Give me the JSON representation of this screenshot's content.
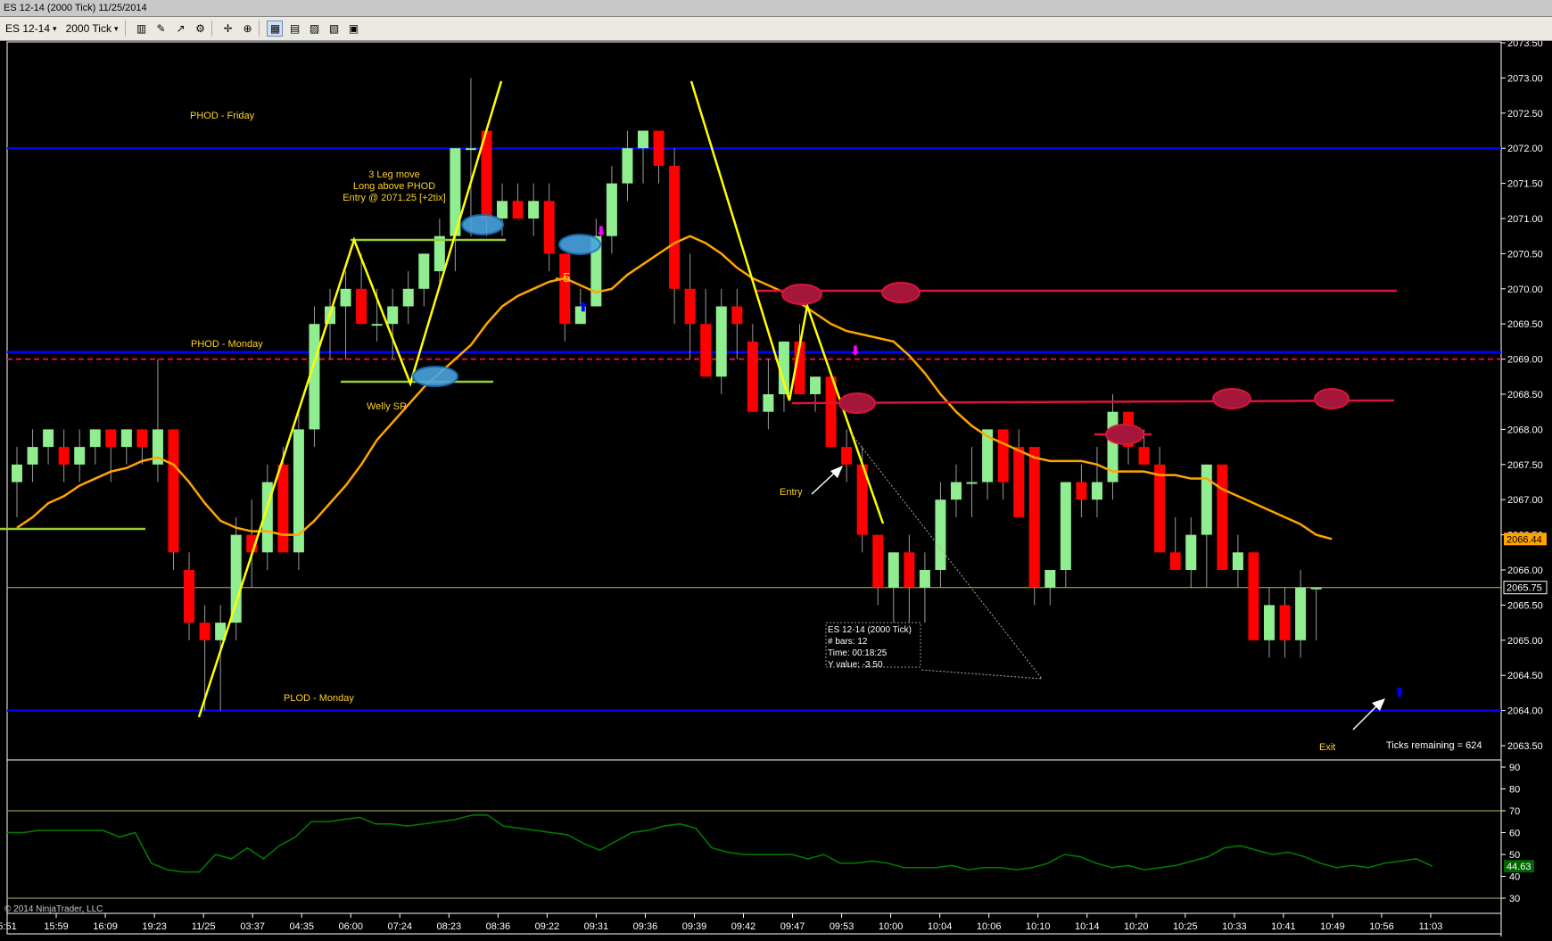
{
  "window": {
    "title": "ES 12-14 (2000 Tick)  11/25/2014"
  },
  "toolbar": {
    "instrument": "ES 12-14",
    "interval": "2000 Tick",
    "icons": [
      "bar-type-icon",
      "pencil-draw-icon",
      "add-indicator-icon",
      "strategy-icon",
      "crosshair-icon",
      "zoom-icon",
      "data-box-icon",
      "chart-settings-icon",
      "chart-trader-icon",
      "properties-icon",
      "print-icon",
      "template-icon"
    ]
  },
  "colors": {
    "up_bar": "#90ee90",
    "down_bar": "#ff0000",
    "ema": "#ffa500",
    "level_blue": "#0000ff",
    "resistance_red": "#dc143c",
    "annotation_yellow": "#ffd21e",
    "oscillator_green": "#008000"
  },
  "price_axis": {
    "ticks": [
      "2073.50",
      "2073.00",
      "2072.50",
      "2072.00",
      "2071.50",
      "2071.00",
      "2070.50",
      "2070.00",
      "2069.50",
      "2069.00",
      "2068.50",
      "2068.00",
      "2067.50",
      "2067.00",
      "2066.50",
      "2066.00",
      "2065.50",
      "2065.00",
      "2064.50",
      "2064.00",
      "2063.50"
    ],
    "ema_label": "2066.44",
    "last_price_label": "2065.75"
  },
  "osc_axis": {
    "ticks": [
      "90",
      "80",
      "70",
      "60",
      "50",
      "40",
      "30"
    ],
    "current_label": "44.63"
  },
  "time_axis": [
    "5:51",
    "15:59",
    "16:09",
    "19:23",
    "11/25",
    "03:37",
    "04:35",
    "06:00",
    "07:24",
    "08:23",
    "08:36",
    "09:22",
    "09:31",
    "09:36",
    "09:39",
    "09:42",
    "09:47",
    "09:53",
    "10:00",
    "10:04",
    "10:06",
    "10:10",
    "10:14",
    "10:20",
    "10:25",
    "10:33",
    "10:41",
    "10:49",
    "10:56",
    "11:03"
  ],
  "annotations": {
    "phod_friday": "PHOD - Friday",
    "phod_monday": "PHOD - Monday",
    "plod_monday": "PLOD - Monday",
    "three_leg_1": "3 Leg move",
    "three_leg_2": "Long above PHOD",
    "three_leg_3": "Entry @ 2071.25 [+2tix]",
    "welly_sr": "Welly SR",
    "minus_five": "- 5",
    "entry": "Entry",
    "exit": "Exit",
    "ticks_remaining": "Ticks remaining = 624",
    "copyright": "© 2014 NinjaTrader, LLC"
  },
  "databox": {
    "line1": "ES 12-14 (2000 Tick)",
    "line2": "# bars:    12",
    "line3": "Time:      00:18:25",
    "line4": "Y value:  -3.50"
  },
  "chart_data": {
    "type": "candlestick",
    "instrument": "ES 12-14",
    "interval": "2000 Tick",
    "bars": [
      {
        "o": 2067.25,
        "h": 2067.75,
        "l": 2066.75,
        "c": 2067.5
      },
      {
        "o": 2067.5,
        "h": 2068.0,
        "l": 2067.25,
        "c": 2067.75
      },
      {
        "o": 2067.75,
        "h": 2068.0,
        "l": 2067.5,
        "c": 2068.0
      },
      {
        "o": 2067.75,
        "h": 2068.0,
        "l": 2067.25,
        "c": 2067.5
      },
      {
        "o": 2067.5,
        "h": 2068.0,
        "l": 2067.25,
        "c": 2067.75
      },
      {
        "o": 2067.75,
        "h": 2068.0,
        "l": 2067.5,
        "c": 2068.0
      },
      {
        "o": 2068.0,
        "h": 2068.0,
        "l": 2067.25,
        "c": 2067.75
      },
      {
        "o": 2067.75,
        "h": 2068.0,
        "l": 2067.5,
        "c": 2068.0
      },
      {
        "o": 2068.0,
        "h": 2068.0,
        "l": 2067.5,
        "c": 2067.75
      },
      {
        "o": 2067.5,
        "h": 2069.0,
        "l": 2067.25,
        "c": 2068.0
      },
      {
        "o": 2068.0,
        "h": 2068.0,
        "l": 2066.0,
        "c": 2066.25
      },
      {
        "o": 2066.0,
        "h": 2066.25,
        "l": 2065.0,
        "c": 2065.25
      },
      {
        "o": 2065.25,
        "h": 2065.5,
        "l": 2064.0,
        "c": 2065.0
      },
      {
        "o": 2065.0,
        "h": 2065.5,
        "l": 2064.0,
        "c": 2065.25
      },
      {
        "o": 2065.25,
        "h": 2066.75,
        "l": 2065.0,
        "c": 2066.5
      },
      {
        "o": 2066.5,
        "h": 2067.0,
        "l": 2065.75,
        "c": 2066.25
      },
      {
        "o": 2066.25,
        "h": 2067.5,
        "l": 2066.0,
        "c": 2067.25
      },
      {
        "o": 2067.5,
        "h": 2067.75,
        "l": 2066.25,
        "c": 2066.25
      },
      {
        "o": 2066.25,
        "h": 2068.25,
        "l": 2066.0,
        "c": 2068.0
      },
      {
        "o": 2068.0,
        "h": 2069.75,
        "l": 2067.75,
        "c": 2069.5
      },
      {
        "o": 2069.5,
        "h": 2070.0,
        "l": 2069.0,
        "c": 2069.75
      },
      {
        "o": 2069.75,
        "h": 2070.25,
        "l": 2069.0,
        "c": 2070.0
      },
      {
        "o": 2070.0,
        "h": 2070.5,
        "l": 2069.5,
        "c": 2069.5
      },
      {
        "o": 2069.5,
        "h": 2070.0,
        "l": 2069.25,
        "c": 2069.5
      },
      {
        "o": 2069.5,
        "h": 2070.0,
        "l": 2069.0,
        "c": 2069.75
      },
      {
        "o": 2069.75,
        "h": 2070.25,
        "l": 2069.5,
        "c": 2070.0
      },
      {
        "o": 2070.0,
        "h": 2070.5,
        "l": 2069.75,
        "c": 2070.5
      },
      {
        "o": 2070.25,
        "h": 2071.0,
        "l": 2070.0,
        "c": 2070.75
      },
      {
        "o": 2070.75,
        "h": 2072.0,
        "l": 2070.25,
        "c": 2072.0
      },
      {
        "o": 2072.0,
        "h": 2073.0,
        "l": 2070.75,
        "c": 2072.0
      },
      {
        "o": 2072.25,
        "h": 2072.25,
        "l": 2070.75,
        "c": 2071.0
      },
      {
        "o": 2071.0,
        "h": 2071.5,
        "l": 2070.75,
        "c": 2071.25
      },
      {
        "o": 2071.25,
        "h": 2071.5,
        "l": 2071.0,
        "c": 2071.0
      },
      {
        "o": 2071.0,
        "h": 2071.5,
        "l": 2070.75,
        "c": 2071.25
      },
      {
        "o": 2071.25,
        "h": 2071.5,
        "l": 2070.25,
        "c": 2070.5
      },
      {
        "o": 2070.5,
        "h": 2070.5,
        "l": 2069.25,
        "c": 2069.5
      },
      {
        "o": 2069.5,
        "h": 2070.0,
        "l": 2069.5,
        "c": 2069.75
      },
      {
        "o": 2069.75,
        "h": 2071.0,
        "l": 2069.75,
        "c": 2070.75
      },
      {
        "o": 2070.75,
        "h": 2071.75,
        "l": 2070.5,
        "c": 2071.5
      },
      {
        "o": 2071.5,
        "h": 2072.25,
        "l": 2071.25,
        "c": 2072.0
      },
      {
        "o": 2072.0,
        "h": 2072.25,
        "l": 2071.5,
        "c": 2072.25
      },
      {
        "o": 2072.25,
        "h": 2072.25,
        "l": 2071.5,
        "c": 2071.75
      },
      {
        "o": 2071.75,
        "h": 2072.0,
        "l": 2069.5,
        "c": 2070.0
      },
      {
        "o": 2070.0,
        "h": 2070.5,
        "l": 2069.0,
        "c": 2069.5
      },
      {
        "o": 2069.5,
        "h": 2070.0,
        "l": 2068.75,
        "c": 2068.75
      },
      {
        "o": 2068.75,
        "h": 2070.0,
        "l": 2068.5,
        "c": 2069.75
      },
      {
        "o": 2069.75,
        "h": 2070.0,
        "l": 2069.0,
        "c": 2069.5
      },
      {
        "o": 2069.25,
        "h": 2069.5,
        "l": 2068.25,
        "c": 2068.25
      },
      {
        "o": 2068.25,
        "h": 2069.0,
        "l": 2068.0,
        "c": 2068.5
      },
      {
        "o": 2068.5,
        "h": 2069.25,
        "l": 2068.25,
        "c": 2069.25
      },
      {
        "o": 2069.25,
        "h": 2069.5,
        "l": 2068.5,
        "c": 2068.5
      },
      {
        "o": 2068.5,
        "h": 2068.75,
        "l": 2068.25,
        "c": 2068.75
      },
      {
        "o": 2068.75,
        "h": 2068.75,
        "l": 2067.75,
        "c": 2067.75
      },
      {
        "o": 2067.75,
        "h": 2068.0,
        "l": 2067.25,
        "c": 2067.5
      },
      {
        "o": 2067.5,
        "h": 2067.75,
        "l": 2066.25,
        "c": 2066.5
      },
      {
        "o": 2066.5,
        "h": 2066.5,
        "l": 2065.5,
        "c": 2065.75
      },
      {
        "o": 2065.75,
        "h": 2066.25,
        "l": 2065.25,
        "c": 2066.25
      },
      {
        "o": 2066.25,
        "h": 2066.5,
        "l": 2065.25,
        "c": 2065.75
      },
      {
        "o": 2065.75,
        "h": 2066.25,
        "l": 2065.25,
        "c": 2066.0
      },
      {
        "o": 2066.0,
        "h": 2067.25,
        "l": 2065.75,
        "c": 2067.0
      },
      {
        "o": 2067.0,
        "h": 2067.5,
        "l": 2066.75,
        "c": 2067.25
      },
      {
        "o": 2067.25,
        "h": 2067.75,
        "l": 2066.75,
        "c": 2067.25
      },
      {
        "o": 2067.25,
        "h": 2068.0,
        "l": 2067.0,
        "c": 2068.0
      },
      {
        "o": 2068.0,
        "h": 2068.0,
        "l": 2067.0,
        "c": 2067.25
      },
      {
        "o": 2067.75,
        "h": 2068.0,
        "l": 2066.75,
        "c": 2066.75
      },
      {
        "o": 2067.75,
        "h": 2067.75,
        "l": 2065.5,
        "c": 2065.75
      },
      {
        "o": 2065.75,
        "h": 2066.0,
        "l": 2065.5,
        "c": 2066.0
      },
      {
        "o": 2066.0,
        "h": 2067.25,
        "l": 2065.75,
        "c": 2067.25
      },
      {
        "o": 2067.25,
        "h": 2067.5,
        "l": 2066.75,
        "c": 2067.0
      },
      {
        "o": 2067.0,
        "h": 2067.75,
        "l": 2066.75,
        "c": 2067.25
      },
      {
        "o": 2067.25,
        "h": 2068.5,
        "l": 2067.0,
        "c": 2068.25
      },
      {
        "o": 2068.25,
        "h": 2068.25,
        "l": 2067.5,
        "c": 2067.75
      },
      {
        "o": 2067.75,
        "h": 2068.0,
        "l": 2067.5,
        "c": 2067.5
      },
      {
        "o": 2067.5,
        "h": 2067.75,
        "l": 2066.25,
        "c": 2066.25
      },
      {
        "o": 2066.25,
        "h": 2066.75,
        "l": 2066.0,
        "c": 2066.0
      },
      {
        "o": 2066.0,
        "h": 2066.75,
        "l": 2065.75,
        "c": 2066.5
      },
      {
        "o": 2066.5,
        "h": 2067.5,
        "l": 2065.75,
        "c": 2067.5
      },
      {
        "o": 2067.5,
        "h": 2067.5,
        "l": 2066.0,
        "c": 2066.0
      },
      {
        "o": 2066.0,
        "h": 2066.5,
        "l": 2065.75,
        "c": 2066.25
      },
      {
        "o": 2066.25,
        "h": 2066.25,
        "l": 2065.0,
        "c": 2065.0
      },
      {
        "o": 2065.0,
        "h": 2065.75,
        "l": 2064.75,
        "c": 2065.5
      },
      {
        "o": 2065.5,
        "h": 2065.75,
        "l": 2064.75,
        "c": 2065.0
      },
      {
        "o": 2065.0,
        "h": 2066.0,
        "l": 2064.75,
        "c": 2065.75
      },
      {
        "o": 2065.75,
        "h": 2065.75,
        "l": 2065.0,
        "c": 2065.75
      }
    ],
    "ema": [
      2066.6,
      2066.75,
      2066.95,
      2067.05,
      2067.2,
      2067.3,
      2067.4,
      2067.45,
      2067.55,
      2067.6,
      2067.5,
      2067.25,
      2066.95,
      2066.7,
      2066.6,
      2066.55,
      2066.55,
      2066.5,
      2066.5,
      2066.7,
      2066.95,
      2067.2,
      2067.5,
      2067.85,
      2068.1,
      2068.35,
      2068.6,
      2068.8,
      2069.0,
      2069.2,
      2069.5,
      2069.75,
      2069.9,
      2070.0,
      2070.1,
      2070.15,
      2070.05,
      2069.95,
      2070.0,
      2070.2,
      2070.35,
      2070.5,
      2070.65,
      2070.75,
      2070.65,
      2070.5,
      2070.3,
      2070.15,
      2070.05,
      2069.95,
      2069.8,
      2069.65,
      2069.5,
      2069.4,
      2069.35,
      2069.3,
      2069.25,
      2069.05,
      2068.8,
      2068.5,
      2068.25,
      2068.05,
      2067.9,
      2067.8,
      2067.7,
      2067.6,
      2067.55,
      2067.55,
      2067.55,
      2067.5,
      2067.4,
      2067.4,
      2067.4,
      2067.35,
      2067.35,
      2067.3,
      2067.3,
      2067.15,
      2067.05,
      2066.95,
      2066.85,
      2066.75,
      2066.65,
      2066.5,
      2066.44
    ],
    "levels": [
      {
        "name": "PHOD - Friday",
        "price": 2072.0,
        "color": "blue"
      },
      {
        "name": "PHOD - Monday",
        "price": 2069.1,
        "color": "blue"
      },
      {
        "name": "PLOD - Monday",
        "price": 2064.0,
        "color": "blue"
      },
      {
        "name": "red dashed",
        "price": 2069.0,
        "color": "red"
      },
      {
        "name": "last price",
        "price": 2065.75,
        "color": "khaki"
      }
    ],
    "oscillator": [
      60,
      60,
      61,
      61,
      61,
      61,
      61,
      58,
      60,
      46,
      43,
      42,
      42,
      50,
      48,
      53,
      48,
      54,
      58,
      65,
      65,
      66,
      67,
      64,
      64,
      63,
      64,
      65,
      66,
      68,
      68,
      63,
      62,
      61,
      60,
      59,
      55,
      52,
      56,
      60,
      61,
      63,
      64,
      62,
      53,
      51,
      50,
      50,
      50,
      50,
      48,
      50,
      46,
      46,
      47,
      46,
      44,
      44,
      44,
      45,
      43,
      44,
      44,
      43,
      44,
      46,
      50,
      49,
      46,
      44,
      45,
      43,
      44,
      45,
      47,
      49,
      53,
      54,
      52,
      50,
      51,
      49,
      46,
      44,
      45,
      44,
      46,
      47,
      48,
      44.63
    ],
    "oscillator_range": [
      30,
      90
    ],
    "oscillator_levels": [
      70,
      30
    ],
    "price_range": [
      2063.25,
      2073.75
    ]
  }
}
